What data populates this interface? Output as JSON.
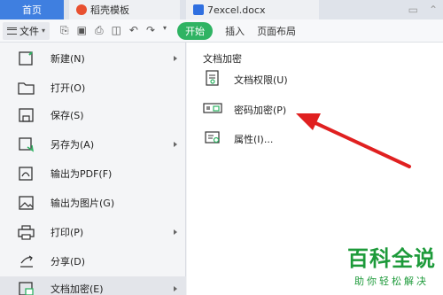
{
  "tabs": {
    "home": "首页",
    "template": "稻壳模板",
    "document": "7excel.docx"
  },
  "toolbar": {
    "file_label": "文件",
    "ribbon": [
      "开始",
      "插入",
      "页面布局"
    ]
  },
  "file_menu": {
    "items": [
      {
        "label": "新建(N)",
        "icon": "new-file-icon"
      },
      {
        "label": "打开(O)",
        "icon": "folder-open-icon"
      },
      {
        "label": "保存(S)",
        "icon": "save-icon"
      },
      {
        "label": "另存为(A)",
        "icon": "save-as-icon"
      },
      {
        "label": "输出为PDF(F)",
        "icon": "pdf-icon"
      },
      {
        "label": "输出为图片(G)",
        "icon": "image-icon"
      },
      {
        "label": "打印(P)",
        "icon": "printer-icon"
      },
      {
        "label": "分享(D)",
        "icon": "share-icon"
      },
      {
        "label": "文档加密(E)",
        "icon": "document-lock-icon"
      }
    ]
  },
  "submenu": {
    "title": "文档加密",
    "items": [
      {
        "label": "文档权限(U)",
        "icon": "document-permission-icon"
      },
      {
        "label": "密码加密(P)",
        "icon": "password-icon"
      },
      {
        "label": "属性(I)...",
        "icon": "properties-icon"
      }
    ]
  },
  "watermark": {
    "main": "百科全说",
    "sub": "助你轻松解决"
  },
  "colors": {
    "home_tab": "#3f7fe0",
    "active_ribbon": "#2fb363",
    "annotation_arrow": "#e02020",
    "watermark": "#1d9a3a"
  }
}
